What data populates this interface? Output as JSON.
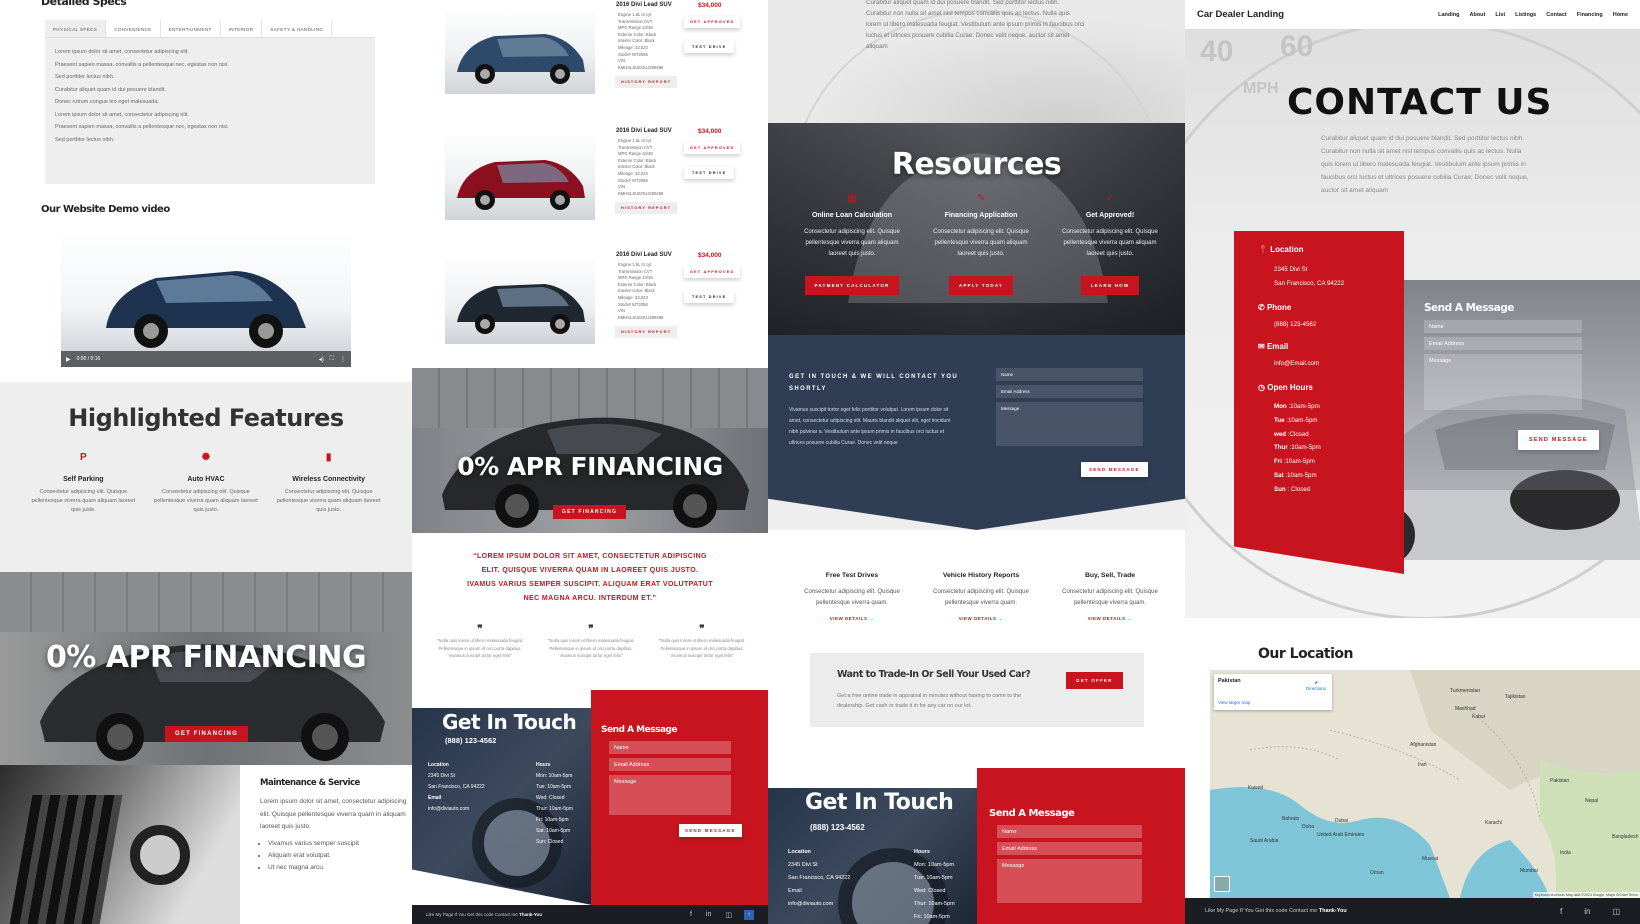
{
  "col1": {
    "specs_title": "Detailed Specs",
    "spec_tabs": [
      "PHYSICAL SPECS",
      "CONVENIENCE",
      "ENTERTAINMENT",
      "INTERIOR",
      "SAFETY & HANDLING"
    ],
    "spec_lines": [
      "Lorem ipsum dolor sit amet, consectetur adipiscing elit.",
      "Praesent sapien massa, convallis a pellentesque nec, egestas non nisi.",
      "Sed porttitor lectus nibh.",
      "Curabitur aliquet quam id dui posuere blandit.",
      "Donec rutrum congue leo eget malesuada.",
      "Lorem ipsum dolor sit amet, consectetur adipiscing elit.",
      "Praesent sapien massa, convallis a pellentesque nec, egestas non nisi.",
      "Sed porttitor lectus nibh."
    ],
    "video_title": "Our Website Demo video",
    "video_time": "0:00 / 0:16",
    "features_title": "Highlighted Features",
    "features": [
      {
        "title": "Self Parking",
        "text": "Consectetur adipiscing elit. Quisque pellentesque viverra quam aliquam laoreet quis justo."
      },
      {
        "title": "Auto HVAC",
        "text": "Consectetur adipiscing elit. Quisque pellentesque viverra quam aliquam laoreet quis justo."
      },
      {
        "title": "Wireless Connectivity",
        "text": "Consectetur adipiscing elit. Quisque pellentesque viverra quam aliquam laoreet quis justo."
      }
    ],
    "apr_title": "0% APR FINANCING",
    "apr_button": "GET FINANCING",
    "maint_title": "Maintenance & Service",
    "maint_text": "Lorem ipsum dolor sit amet, consectetur adipiscing elit. Quisque pellentesque viverra quam in aliquam laoreet quis justo.",
    "maint_bullets": [
      "Vivamus varius semper suscipit",
      "Aliquam erat volutpat.",
      "Ut nec magna arcu."
    ]
  },
  "col2": {
    "listings": [
      {
        "title": "2016 Divi Lead SUV",
        "price": "$34,000",
        "specs": [
          "Engine 1.5L I4 cyl",
          "Transmission CVT",
          "MPG Range 24/38",
          "Exterior Color: Black",
          "Interior Color: Black",
          "Mileage: 33,023",
          "Stock# WT2056",
          "VIN",
          "KMHSLSUEOUJ289486"
        ],
        "color": "#2d4a6b"
      },
      {
        "title": "2016 Divi Lead SUV",
        "price": "$34,000",
        "specs": [
          "Engine 1.5L I4 cyl",
          "Transmission CVT",
          "MPG Range 24/38",
          "Exterior Color: Black",
          "Interior Color: Black",
          "Mileage: 33,023",
          "Stock# WT2056",
          "VIN",
          "KMHSLSUEOUJ289486"
        ],
        "color": "#8a1020"
      },
      {
        "title": "2016 Divi Lead SUV",
        "price": "$34,000",
        "specs": [
          "Engine 1.5L I4 cyl",
          "Transmission CVT",
          "MPG Range 24/38",
          "Exterior Color: Black",
          "Interior Color: Black",
          "Mileage: 33,023",
          "Stock# WT2056",
          "VIN",
          "KMHSLSUEOUJ289486"
        ],
        "color": "#1f2730"
      }
    ],
    "btn_approved": "GET APPROVED",
    "btn_test": "TEST DRIVE",
    "btn_history": "HISTORY REPORT",
    "apr_title": "0% APR FINANCING",
    "apr_button": "GET FINANCING",
    "quote": "“LOREM IPSUM DOLOR SIT AMET, CONSECTETUR ADIPISCING ELIT. QUISQUE VIVERRA QUAM IN LAOREET QUIS JUSTO. IVAMUS VARIUS SEMPER SUSCIPIT. ALIQUAM ERAT VOLUTPATUT NEC MAGNA ARCU. INTERDUM ET.”",
    "testimonials": [
      "\"Nulla quis lorem ut libero malesuada feugiat. Pellentesque in ipsum id orci porta dapibus. Vivamus suscipit tortor eget felis\"",
      "\"Nulla quis lorem ut libero malesuada feugiat. Pellentesque in ipsum id orci porta dapibus. Vivamus suscipit tortor eget felis\"",
      "\"Nulla quis lorem ut libero malesuada feugiat. Pellentesque in ipsum id orci porta dapibus. Vivamus suscipit tortor eget felis\""
    ],
    "git_title": "Get In Touch",
    "git_phone": "(888) 123-4562",
    "loc_label": "Location",
    "loc_lines": [
      "2345 Divi St",
      "San Francisco, CA 94222"
    ],
    "email_label": "Email",
    "email": "info@diviauto.com",
    "hours_label": "Hours",
    "hours": [
      "Mon: 10am-5pm",
      "Tue: 10am-5pm",
      "Wed: Closed",
      "Thur: 10am-5pm",
      "Fri: 10am-5pm",
      "Sat: 10am-5pm",
      "Sun: Closed"
    ],
    "send_title": "Send A Message",
    "name_ph": "Name",
    "email_ph": "Email Address",
    "msg_ph": "Message",
    "send_btn": "Send Message",
    "footer_text": "Like My Page If You Get this code Contact me",
    "footer_bold": "Thank-You"
  },
  "col3": {
    "intro": "Curabitur aliquet quam id dui posuere blandit. Sed porttitor lectus nibh. Curabitur non nulla sit amet nisl tempus convallis quis ac lectus. Nulla quis lorem ut libero malesuada feugiat. Vestibulum ante ipsum primis in faucibus orci luctus et ultrices posuere cubilia Curae; Donec velit neque, auctor sit amet aliquam",
    "resources_title": "Resources",
    "resources": [
      {
        "title": "Online Loan Calculation",
        "text": "Consectetur adipiscing elit. Quisque pellentesque viverra quam aliquam laoreet quis justo.",
        "btn": "PAYMENT CALCULATOR"
      },
      {
        "title": "Financing Application",
        "text": "Consectetur adipiscing elit. Quisque pellentesque viverra quam aliquam laoreet quis justo.",
        "btn": "APPLY TODAY"
      },
      {
        "title": "Get Approved!",
        "text": "Consectetur adipiscing elit. Quisque pellentesque viverra quam aliquam laoreet quis justo.",
        "btn": "LEARN HOW"
      }
    ],
    "contact_heading": "GET IN TOUCH & WE WILL CONTACT YOU SHORTLY",
    "contact_text": "Vivamus suscipit tortor eget felis porttitor volutpat. Lorem ipsum dolor sit amet, consectetur adipiscing elit. Mauris blandit aliquet elit, eget tincidunt nibh pulvinar a. Vestibulum ante ipsum primis in faucibus orci luctus et ultrices posuere cubilia Curae. Donec velit neque",
    "name_ph": "Name",
    "email_ph": "Email Address",
    "msg_ph": "Message",
    "send_btn": "Send Message",
    "services": [
      {
        "title": "Free Test Drives",
        "text": "Consectetur adipiscing elit. Quisque pellentesque viverra quam.",
        "link": "VIEW DETAILS →"
      },
      {
        "title": "Vehicle History Reports",
        "text": "Consectetur adipiscing elit. Quisque pellentesque viverra quam.",
        "link": "VIEW DETAILS →"
      },
      {
        "title": "Buy, Sell, Trade",
        "text": "Consectetur adipiscing elit. Quisque pellentesque viverra quam.",
        "link": "VIEW DETAILS →"
      }
    ],
    "trade_title": "Want to Trade-In Or Sell Your Used Car?",
    "trade_text": "Get a free online trade in appraisal in minutes without having to come to the dealership. Get cash or trade it in for any car on our lot.",
    "trade_btn": "GET OFFER",
    "git_title": "Get In Touch",
    "git_phone": "(888) 123-4562",
    "loc_label": "Location",
    "loc_lines": [
      "2345 Divi St",
      "San Francisco, CA 94222"
    ],
    "email_label": "Email",
    "email": "info@diviauto.com",
    "hours_label": "Hours",
    "hours": [
      "Mon: 10am-5pm",
      "Tue: 10am-5pm",
      "Wed: Closed",
      "Thur: 10am-5pm",
      "Fri: 10am-5pm"
    ],
    "send_title": "Send A Message"
  },
  "col4": {
    "brand": "Car Dealer Landing",
    "nav": [
      "Landing",
      "About",
      "List",
      "Listings",
      "Contact",
      "Financing",
      "Home"
    ],
    "contact_title": "CONTACT US",
    "contact_text": "Curabitur aliquet quam id dui posuere blandit. Sed porttitor lectus nibh. Curabitur non nulla sit amet nisl tempus convallis quis ac lectus. Nulla quis lorem ut libero malesuada feugiat. Vestibulum ante ipsum primis in faucibus orci luctus et ultrices posuere cubilia Curae; Donec velit neque, auctor sit amet aliquam",
    "loc_label": "Location",
    "loc_lines": [
      "2345 Divi St",
      "San Francisco, CA 94222"
    ],
    "phone_label": "Phone",
    "phone": "(888) 123-4562",
    "email_label": "Email",
    "email": "info@Email.com",
    "hours_label": "Open Hours",
    "hours": [
      {
        "d": "Mon",
        "t": " :10am-5pm"
      },
      {
        "d": "Tue",
        "t": " :10am-5pm"
      },
      {
        "d": "wed",
        "t": " :Closed"
      },
      {
        "d": "Thur",
        "t": " :10am-5pm"
      },
      {
        "d": "Fri",
        "t": " :10am-5pm"
      },
      {
        "d": "Sat",
        "t": " :10am-5pm"
      },
      {
        "d": "Sun",
        "t": " : Closed"
      }
    ],
    "send_title": "Send A Message",
    "name_ph": "Name",
    "email_ph": "Email Address",
    "msg_ph": "Message",
    "send_btn": "Send Message",
    "location_title": "Our Location",
    "map_labels": [
      "Pakistan",
      "Turkmenistan",
      "Tajikistan",
      "Mashhad",
      "Kabul",
      "Afghanistan",
      "Iran",
      "Pakistan",
      "Kuwait",
      "Bahrain",
      "Doha",
      "Dubai",
      "United Arab Emirates",
      "Saudi Arabia",
      "Oman",
      "Muscat",
      "Karachi",
      "India",
      "Nepal",
      "Bangladesh",
      "Mumbai"
    ],
    "map_card_title": "Pakistan",
    "map_card_link": "View larger map",
    "map_directions": "Directions",
    "map_footer": "Keyboard shortcuts   Map data ©2024 Google, Mapa GISrael   Terms",
    "footer_text": "Like My Page If You Get this code Contact me",
    "footer_bold": "Thank-You"
  }
}
